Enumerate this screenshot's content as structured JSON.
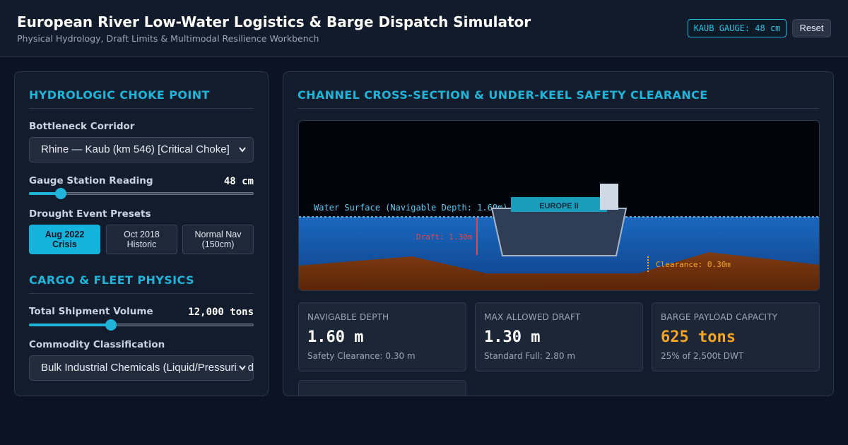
{
  "header": {
    "title": "European River Low-Water Logistics & Barge Dispatch Simulator",
    "subtitle": "Physical Hydrology, Draft Limits & Multimodal Resilience Workbench",
    "gauge_badge": "KAUB GAUGE: 48 cm",
    "reset_label": "Reset"
  },
  "left": {
    "hydro": {
      "title": "HYDROLOGIC CHOKE POINT",
      "corridor_label": "Bottleneck Corridor",
      "corridor_value": "Rhine — Kaub (km 546) [Critical Choke]",
      "gauge_label": "Gauge Station Reading",
      "gauge_value": "48 cm",
      "gauge_level": 0.14,
      "presets_label": "Drought Event Presets",
      "presets": [
        {
          "line1": "Aug 2022",
          "line2": "Crisis",
          "active": true
        },
        {
          "line1": "Oct 2018",
          "line2": "Historic",
          "active": false
        },
        {
          "line1": "Normal Nav",
          "line2": "(150cm)",
          "active": false
        }
      ]
    },
    "cargo": {
      "title": "CARGO & FLEET PHYSICS",
      "volume_label": "Total Shipment Volume",
      "volume_value": "12,000 tons",
      "volume_level": 0.365,
      "commodity_label": "Commodity Classification",
      "commodity_value": "Bulk Industrial Chemicals (Liquid/Pressurized)"
    }
  },
  "right": {
    "title": "CHANNEL CROSS-SECTION & UNDER-KEEL SAFETY CLEARANCE",
    "scene": {
      "water_label": "Water Surface (Navigable Depth: 1.60m)",
      "vessel_name": "EUROPE II",
      "draft_label": "Draft: 1.30m",
      "clearance_label": "Clearance: 0.30m"
    },
    "cards": [
      {
        "label": "NAVIGABLE DEPTH",
        "value": "1.60 m",
        "sub": "Safety Clearance: 0.30 m",
        "warn": false
      },
      {
        "label": "MAX ALLOWED DRAFT",
        "value": "1.30 m",
        "sub": "Standard Full: 2.80 m",
        "warn": false
      },
      {
        "label": "BARGE PAYLOAD CAPACITY",
        "value": "625 tons",
        "sub": "25% of 2,500t DWT",
        "warn": true
      }
    ]
  },
  "colors": {
    "accent": "#1fb4d8",
    "warning": "#f5a524",
    "draft_marker": "#e0464e",
    "clearance_marker": "#f5a524",
    "riverbed": "#7a3510",
    "water": "#1450a0"
  }
}
